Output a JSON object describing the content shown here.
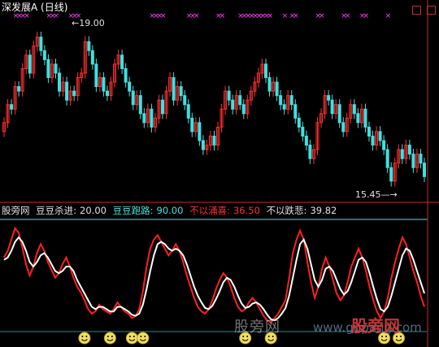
{
  "title": "深发展A (日线)",
  "price_annotations": {
    "high": "19.00",
    "low": "15.45"
  },
  "indicator": {
    "name": "股旁网",
    "items": [
      {
        "label": "豆豆杀进:",
        "value": "20.00",
        "color": "white"
      },
      {
        "label": "豆豆跑路:",
        "value": "90.00",
        "color": "cyan"
      },
      {
        "label": "不以涌喜:",
        "value": "36.50",
        "color": "red"
      },
      {
        "label": "不以跌悲:",
        "value": "39.82",
        "color": "white"
      }
    ]
  },
  "watermark": {
    "text1": "股旁网",
    "text2": "www.gupang.com",
    "logo": "股旁网"
  },
  "colors": {
    "up": "#ff3030",
    "down": "#40e0e0",
    "k_line": "#ff2020",
    "d_line": "#ffffff",
    "marker": "#ff40ff",
    "axis": "#c03030",
    "ref_line": "#4fe0e0"
  },
  "chart_data": [
    {
      "type": "candlestick",
      "title": "深发展A (日线)",
      "annotations": [
        {
          "text": "19.00",
          "kind": "high"
        },
        {
          "text": "15.45",
          "kind": "low"
        }
      ],
      "close": [
        16.9,
        17.3,
        17.2,
        17.7,
        17.6,
        18.1,
        18.4,
        18.0,
        18.6,
        18.8,
        18.5,
        18.3,
        17.9,
        18.2,
        18.0,
        17.6,
        17.8,
        17.4,
        17.6,
        17.5,
        17.9,
        18.0,
        18.7,
        18.5,
        18.2,
        17.7,
        17.9,
        17.6,
        17.5,
        17.8,
        18.2,
        18.4,
        18.1,
        17.8,
        17.6,
        17.3,
        17.5,
        17.1,
        16.9,
        17.2,
        16.8,
        17.0,
        17.4,
        17.1,
        17.6,
        17.9,
        17.4,
        17.7,
        17.5,
        17.3,
        17.0,
        16.7,
        16.9,
        16.5,
        16.3,
        16.4,
        16.6,
        16.4,
        16.8,
        17.2,
        17.6,
        17.4,
        17.2,
        17.5,
        17.3,
        17.1,
        17.4,
        17.6,
        17.8,
        18.0,
        18.2,
        17.9,
        17.6,
        17.8,
        17.5,
        17.3,
        17.2,
        17.5,
        17.3,
        17.0,
        16.8,
        16.6,
        16.4,
        16.1,
        16.3,
        16.9,
        17.1,
        17.5,
        17.4,
        17.1,
        17.3,
        16.9,
        16.7,
        17.0,
        17.3,
        17.1,
        16.9,
        17.2,
        16.8,
        16.6,
        16.4,
        16.7,
        16.5,
        16.3,
        15.9,
        15.6,
        16.0,
        16.3,
        16.1,
        16.4,
        16.2,
        15.9,
        16.2,
        16.0,
        15.7
      ],
      "k": [
        66,
        72,
        82,
        92,
        88,
        75,
        60,
        50,
        58,
        70,
        78,
        72,
        62,
        55,
        48,
        52,
        60,
        66,
        58,
        48,
        40,
        35,
        28,
        20,
        16,
        18,
        24,
        20,
        18,
        16,
        20,
        26,
        22,
        18,
        16,
        12,
        14,
        20,
        36,
        58,
        74,
        82,
        86,
        80,
        74,
        68,
        72,
        78,
        72,
        62,
        50,
        40,
        30,
        22,
        18,
        16,
        20,
        28,
        38,
        46,
        52,
        48,
        40,
        30,
        22,
        18,
        20,
        26,
        30,
        26,
        20,
        14,
        10,
        8,
        12,
        16,
        22,
        28,
        48,
        70,
        82,
        90,
        82,
        62,
        44,
        30,
        40,
        56,
        66,
        58,
        46,
        34,
        28,
        32,
        44,
        58,
        66,
        74,
        66,
        54,
        40,
        28,
        18,
        12,
        18,
        30,
        48,
        62,
        74,
        84,
        78,
        66,
        54,
        44,
        32,
        22
      ],
      "d": [
        64,
        66,
        72,
        80,
        84,
        80,
        72,
        62,
        58,
        62,
        68,
        70,
        66,
        60,
        54,
        52,
        54,
        58,
        58,
        54,
        46,
        40,
        34,
        28,
        22,
        20,
        22,
        22,
        20,
        18,
        18,
        22,
        22,
        20,
        18,
        15,
        14,
        16,
        24,
        38,
        54,
        68,
        78,
        80,
        78,
        74,
        72,
        74,
        72,
        68,
        60,
        50,
        40,
        32,
        26,
        21,
        20,
        23,
        29,
        36,
        44,
        48,
        46,
        40,
        32,
        25,
        21,
        22,
        25,
        26,
        24,
        20,
        15,
        11,
        10,
        12,
        16,
        21,
        32,
        48,
        64,
        78,
        82,
        74,
        60,
        46,
        40,
        46,
        56,
        58,
        54,
        46,
        38,
        33,
        36,
        44,
        54,
        64,
        66,
        62,
        52,
        40,
        29,
        20,
        18,
        22,
        32,
        44,
        56,
        68,
        74,
        72,
        64,
        54,
        44,
        34
      ],
      "thresholds": {
        "buy": 20.0,
        "sell": 90.0
      },
      "last_values": {
        "豆豆杀进": 20.0,
        "豆豆跑路": 90.0,
        "不以涌喜": 36.5,
        "不以跌悲": 39.82
      }
    }
  ]
}
